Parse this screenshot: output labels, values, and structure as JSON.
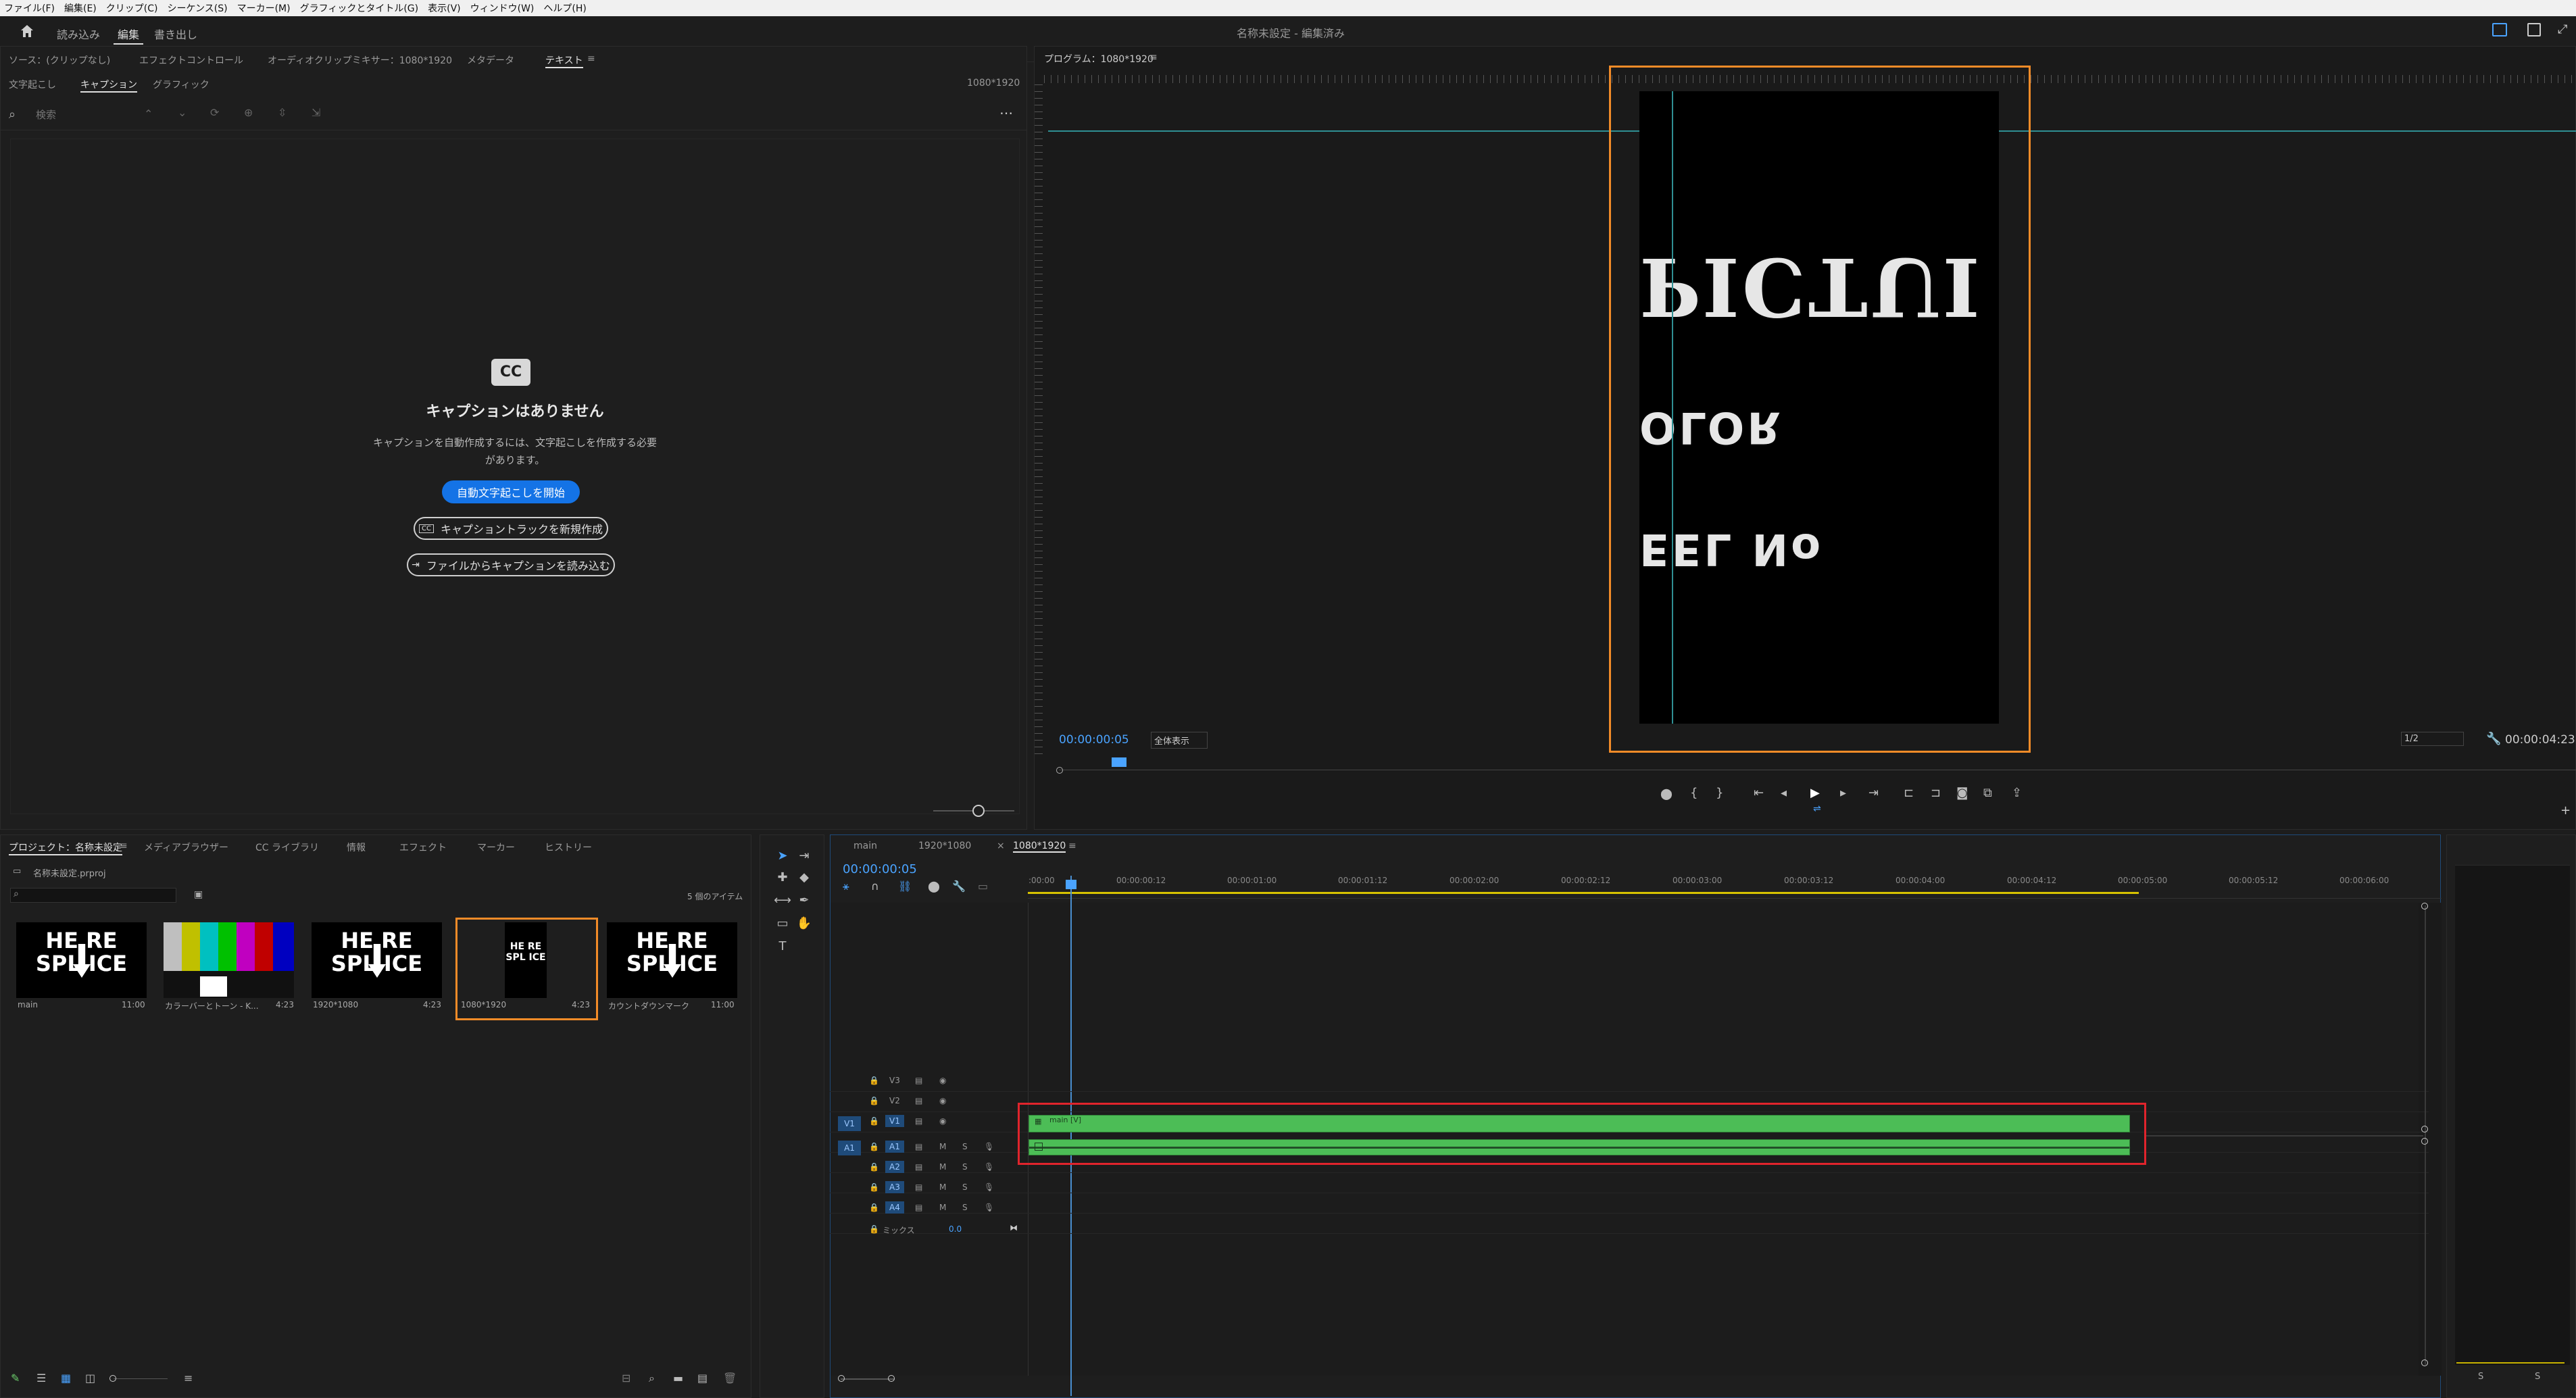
{
  "menu": [
    "ファイル(F)",
    "編集(E)",
    "クリップ(C)",
    "シーケンス(S)",
    "マーカー(M)",
    "グラフィックとタイトル(G)",
    "表示(V)",
    "ウィンドウ(W)",
    "ヘルプ(H)"
  ],
  "workspace": {
    "tabs": [
      "読み込み",
      "編集",
      "書き出し"
    ],
    "active": "編集",
    "title": "名称未設定 - 編集済み"
  },
  "source_panel": {
    "tabs": [
      "ソース：(クリップなし)",
      "エフェクトコントロール",
      "オーディオクリップミキサー：1080*1920",
      "メタデータ",
      "テキスト"
    ],
    "active_tab": "テキスト",
    "subtabs": [
      "文字起こし",
      "キャプション",
      "グラフィック"
    ],
    "active_subtab": "キャプション",
    "sequence_label": "1080*1920",
    "search_placeholder": "検索",
    "empty_title": "キャプションはありません",
    "empty_desc_line1": "キャプションを自動作成するには、文字起こしを作成する必要",
    "empty_desc_line2": "があります。",
    "btn_auto": "自動文字起こしを開始",
    "btn_new_track": "キャプショントラックを新規作成",
    "btn_import": "ファイルからキャプションを読み込む",
    "cc_icon_text": "CC"
  },
  "program_monitor": {
    "title": "プログラム：1080*1920",
    "timecode": "00:00:00:05",
    "fit": "全体表示",
    "resolution": "1/2",
    "duration": "00:00:04:23",
    "frame_text": [
      "PICTUI",
      "OLOR",
      "EEL No"
    ],
    "accent_color": "#f28b28"
  },
  "project_panel": {
    "tabs": [
      "プロジェクト：名称未設定",
      "メディアブラウザー",
      "CC ライブラリ",
      "情報",
      "エフェクト",
      "マーカー",
      "ヒストリー"
    ],
    "file": "名称未設定.prproj",
    "item_count": "5 個のアイテム",
    "items": [
      {
        "name": "main",
        "dur": "11:00"
      },
      {
        "name": "カラーバーとトーン - K...",
        "dur": "4:23"
      },
      {
        "name": "1920*1080",
        "dur": "4:23"
      },
      {
        "name": "1080*1920",
        "dur": "4:23"
      },
      {
        "name": "カウントダウンマーク",
        "dur": "11:00"
      }
    ],
    "thumb_text": [
      "HE RE",
      "SPL ICE"
    ]
  },
  "timeline": {
    "tabs": [
      "main",
      "1920*1080",
      "1080*1920"
    ],
    "active_tab": "1080*1920",
    "timecode": "00:00:00:05",
    "ruler": [
      ":00:00",
      "00:00:00:12",
      "00:00:01:00",
      "00:00:01:12",
      "00:00:02:00",
      "00:00:02:12",
      "00:00:03:00",
      "00:00:03:12",
      "00:00:04:00",
      "00:00:04:12",
      "00:00:05:00",
      "00:00:05:12",
      "00:00:06:00"
    ],
    "tracks": [
      "V3",
      "V2",
      "V1",
      "A1",
      "A2",
      "A3",
      "A4"
    ],
    "mix_label": "ミックス",
    "mix_value": "0.0",
    "clip_label": "main [V]",
    "clip_color": "#4cbd56",
    "highlight_color": "#e0242c"
  },
  "audio_meter": {
    "labels": [
      "S",
      "S"
    ]
  }
}
